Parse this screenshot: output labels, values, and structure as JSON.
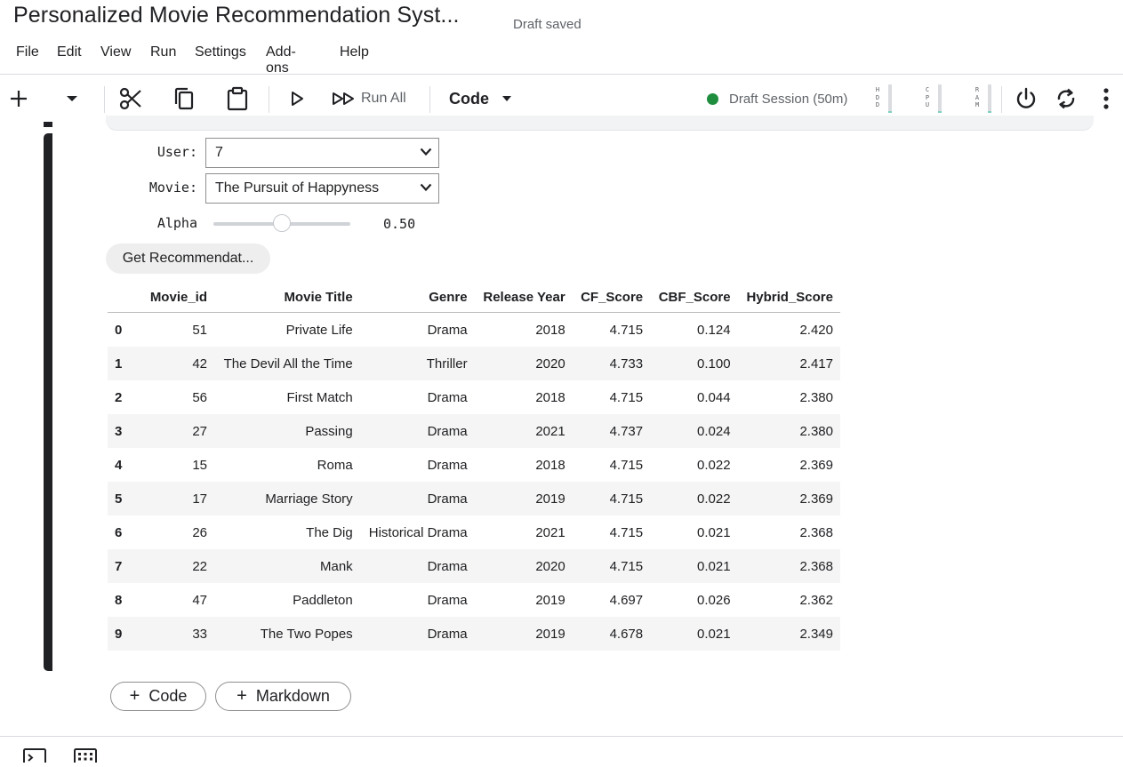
{
  "header": {
    "title": "Personalized Movie Recommendation Syst...",
    "status": "Draft saved"
  },
  "menu": [
    "File",
    "Edit",
    "View",
    "Run",
    "Settings",
    "Add-ons",
    "Help"
  ],
  "toolbar": {
    "run_all_label": "Run All",
    "cell_type": "Code",
    "session_label": "Draft Session (50m)",
    "session_color": "#1e8e3e",
    "meters": [
      {
        "label": "HDD",
        "level": 0.05
      },
      {
        "label": "CPU",
        "level": 0.05
      },
      {
        "label": "RAM",
        "level": 0.05
      }
    ]
  },
  "widgets": {
    "user_label": "User:",
    "user_value": "7",
    "movie_label": "Movie:",
    "movie_value": "The Pursuit of Happyness",
    "alpha_label": "Alpha",
    "alpha_value": "0.50",
    "alpha_level": 0.5,
    "button_label": "Get Recommendat..."
  },
  "table": {
    "columns": [
      "Movie_id",
      "Movie Title",
      "Genre",
      "Release Year",
      "CF_Score",
      "CBF_Score",
      "Hybrid_Score"
    ],
    "rows": [
      [
        "0",
        "51",
        "Private Life",
        "Drama",
        "2018",
        "4.715",
        "0.124",
        "2.420"
      ],
      [
        "1",
        "42",
        "The Devil All the Time",
        "Thriller",
        "2020",
        "4.733",
        "0.100",
        "2.417"
      ],
      [
        "2",
        "56",
        "First Match",
        "Drama",
        "2018",
        "4.715",
        "0.044",
        "2.380"
      ],
      [
        "3",
        "27",
        "Passing",
        "Drama",
        "2021",
        "4.737",
        "0.024",
        "2.380"
      ],
      [
        "4",
        "15",
        "Roma",
        "Drama",
        "2018",
        "4.715",
        "0.022",
        "2.369"
      ],
      [
        "5",
        "17",
        "Marriage Story",
        "Drama",
        "2019",
        "4.715",
        "0.022",
        "2.369"
      ],
      [
        "6",
        "26",
        "The Dig",
        "Historical Drama",
        "2021",
        "4.715",
        "0.021",
        "2.368"
      ],
      [
        "7",
        "22",
        "Mank",
        "Drama",
        "2020",
        "4.715",
        "0.021",
        "2.368"
      ],
      [
        "8",
        "47",
        "Paddleton",
        "Drama",
        "2019",
        "4.697",
        "0.026",
        "2.362"
      ],
      [
        "9",
        "33",
        "The Two Popes",
        "Drama",
        "2019",
        "4.678",
        "0.021",
        "2.349"
      ]
    ]
  },
  "add_cell": {
    "code_label": "Code",
    "markdown_label": "Markdown"
  },
  "icons": [
    "add-icon",
    "chevron-down-icon",
    "cut-icon",
    "copy-icon",
    "paste-icon",
    "run-icon",
    "run-all-icon",
    "power-icon",
    "restart-icon",
    "more-icon",
    "terminal-icon",
    "keyboard-icon"
  ]
}
